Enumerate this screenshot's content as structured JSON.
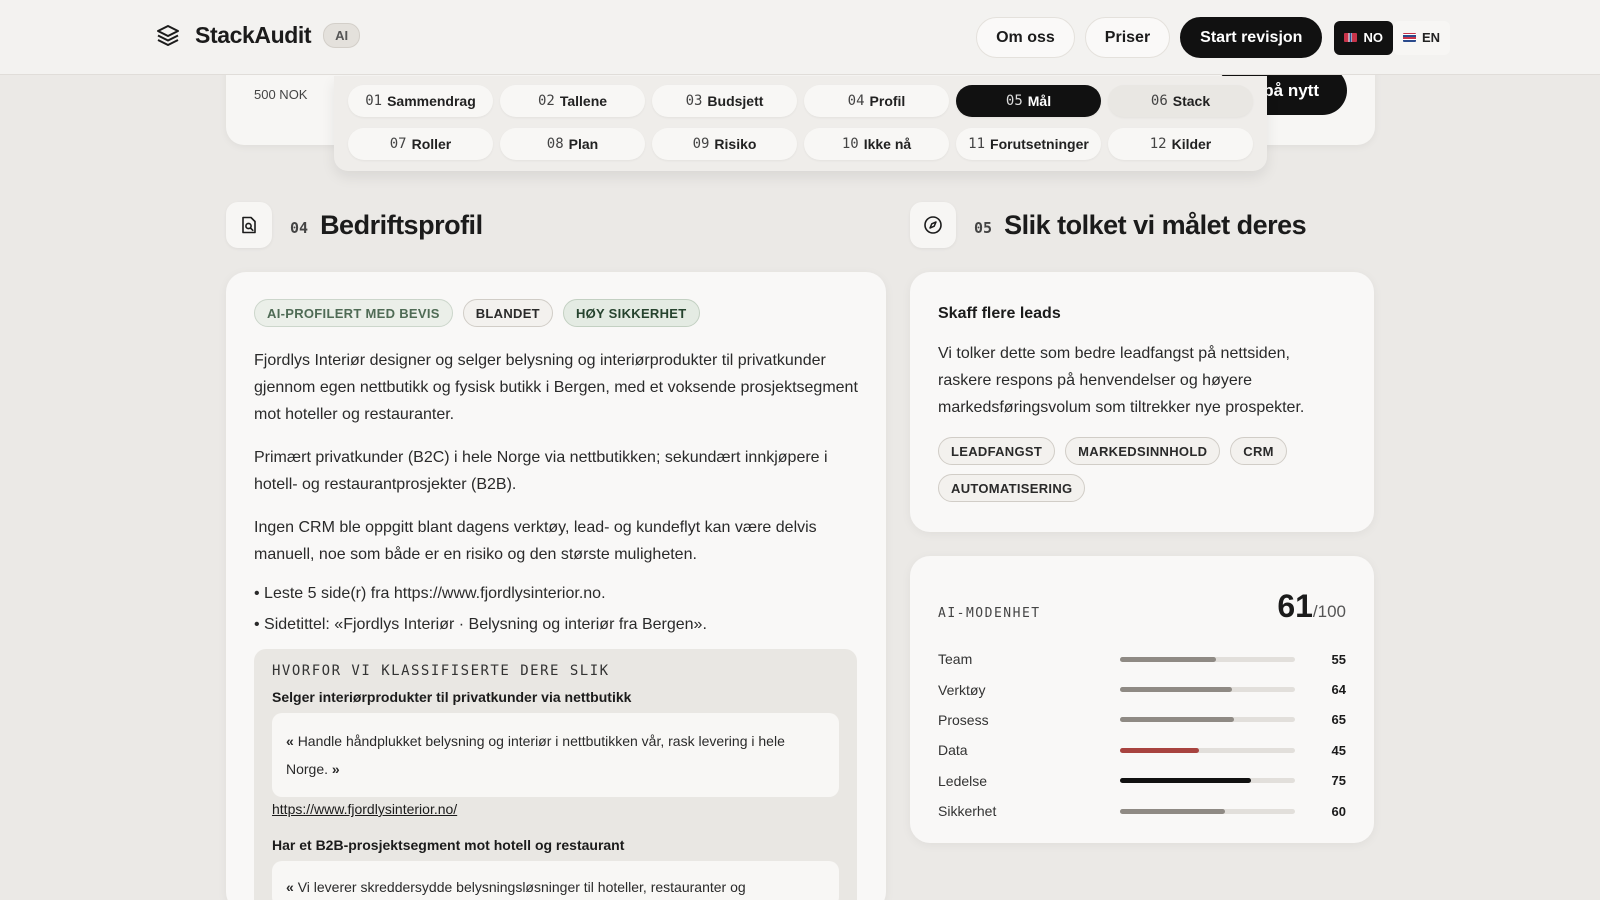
{
  "brand": {
    "name": "StackAudit",
    "badge": "AI"
  },
  "nav": {
    "about": "Om oss",
    "pricing": "Priser",
    "start": "Start revisjon",
    "languages": [
      {
        "code": "NO",
        "active": true
      },
      {
        "code": "EN",
        "active": false
      }
    ]
  },
  "top_card": {
    "price": "500 NOK",
    "button": "på nytt"
  },
  "tabs": [
    {
      "num": "01",
      "label": "Sammendrag",
      "state": "normal"
    },
    {
      "num": "02",
      "label": "Tallene",
      "state": "normal"
    },
    {
      "num": "03",
      "label": "Budsjett",
      "state": "normal"
    },
    {
      "num": "04",
      "label": "Profil",
      "state": "normal"
    },
    {
      "num": "05",
      "label": "Mål",
      "state": "active"
    },
    {
      "num": "06",
      "label": "Stack",
      "state": "soft"
    },
    {
      "num": "07",
      "label": "Roller",
      "state": "normal"
    },
    {
      "num": "08",
      "label": "Plan",
      "state": "normal"
    },
    {
      "num": "09",
      "label": "Risiko",
      "state": "normal"
    },
    {
      "num": "10",
      "label": "Ikke nå",
      "state": "normal"
    },
    {
      "num": "11",
      "label": "Forutsetninger",
      "state": "normal"
    },
    {
      "num": "12",
      "label": "Kilder",
      "state": "normal"
    }
  ],
  "profile": {
    "num": "04",
    "title": "Bedriftsprofil",
    "icon": "document-search-icon",
    "chips": [
      "AI-PROFILERT MED BEVIS",
      "BLANDET",
      "HØY SIKKERHET"
    ],
    "paragraphs": [
      "Fjordlys Interiør designer og selger belysning og interiørprodukter til privatkunder gjennom egen nettbutikk og fysisk butikk i Bergen, med et voksende prosjektsegment mot hoteller og restauranter.",
      "Primært privatkunder (B2C) i hele Norge via nettbutikken; sekundært innkjøpere i hotell- og restaurantprosjekter (B2B).",
      "Ingen CRM ble oppgitt blant dagens verktøy, lead- og kundeflyt kan være delvis manuell, noe som både er en risiko og den største muligheten."
    ],
    "bullets": [
      "• Leste 5 side(r) fra https://www.fjordlysinterior.no.",
      "• Sidetittel: «Fjordlys Interiør · Belysning og interiør fra Bergen»."
    ],
    "why": {
      "title": "HVORFOR VI KLASSIFISERTE DERE SLIK",
      "item1_title": "Selger interiørprodukter til privatkunder via nettbutikk",
      "item1_quote": "Handle håndplukket belysning og interiør i nettbutikken vår, rask levering i hele Norge.",
      "item1_link": "https://www.fjordlysinterior.no/",
      "item2_title": "Har et B2B-prosjektsegment mot hotell og restaurant",
      "item2_quote": "Vi leverer skreddersydde belysningsløsninger til hoteller, restauranter og"
    }
  },
  "goal": {
    "num": "05",
    "title": "Slik tolket vi målet deres",
    "icon": "compass-icon",
    "heading": "Skaff flere leads",
    "text": "Vi tolker dette som bedre leadfangst på nettsiden, raskere respons på henvendelser og høyere markedsføringsvolum som tiltrekker nye prospekter.",
    "chips": [
      "LEADFANGST",
      "MARKEDSINNHOLD",
      "CRM",
      "AUTOMATISERING"
    ]
  },
  "maturity": {
    "label": "AI-MODENHET",
    "score": "61",
    "max": "/100",
    "rows": [
      {
        "name": "Team",
        "value": 55,
        "color": "#8f8a84"
      },
      {
        "name": "Verktøy",
        "value": 64,
        "color": "#8f8a84"
      },
      {
        "name": "Prosess",
        "value": 65,
        "color": "#8f8a84"
      },
      {
        "name": "Data",
        "value": 45,
        "color": "#a8433f"
      },
      {
        "name": "Ledelse",
        "value": 75,
        "color": "#111111"
      },
      {
        "name": "Sikkerhet",
        "value": 60,
        "color": "#8f8a84"
      }
    ]
  }
}
